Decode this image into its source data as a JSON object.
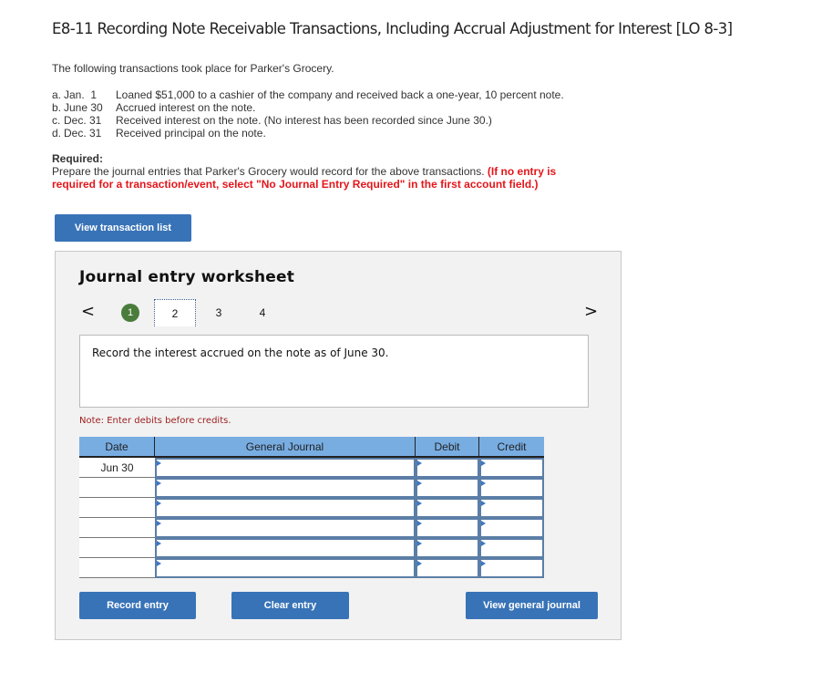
{
  "header": {
    "title": "E8-11 Recording Note Receivable Transactions, Including Accrual Adjustment for Interest [LO 8-3]"
  },
  "intro": "The following transactions took place for Parker's Grocery.",
  "transactions": [
    {
      "letter": "a.",
      "date": "Jan.  1",
      "text": "Loaned $51,000 to a cashier of the company and received back a one-year, 10 percent note."
    },
    {
      "letter": "b.",
      "date": "June 30",
      "text": "Accrued interest on the note."
    },
    {
      "letter": "c.",
      "date": "Dec. 31",
      "text": "Received interest on the note. (No interest has been recorded since June 30.)"
    },
    {
      "letter": "d.",
      "date": "Dec. 31",
      "text": "Received principal on the note."
    }
  ],
  "required": {
    "heading": "Required:",
    "text": "Prepare the journal entries that Parker's Grocery would record for the above transactions.",
    "warning": "(If no entry is required for a transaction/event, select \"No Journal Entry Required\" in the first account field.)"
  },
  "buttons": {
    "view_transaction_list": "View transaction list",
    "record_entry": "Record entry",
    "clear_entry": "Clear entry",
    "view_general_journal": "View general journal"
  },
  "worksheet": {
    "title": "Journal entry worksheet",
    "nav_prev": "<",
    "nav_next": ">",
    "steps": [
      {
        "label": "1",
        "state": "completed"
      },
      {
        "label": "2",
        "state": "active"
      },
      {
        "label": "3",
        "state": "pending"
      },
      {
        "label": "4",
        "state": "pending"
      }
    ],
    "description": "Record the interest accrued on the note as of June 30.",
    "note": "Note: Enter debits before credits."
  },
  "journal": {
    "columns": [
      "Date",
      "General Journal",
      "Debit",
      "Credit"
    ],
    "rows": [
      {
        "date": "Jun 30",
        "account": "",
        "debit": "",
        "credit": ""
      },
      {
        "date": "",
        "account": "",
        "debit": "",
        "credit": ""
      },
      {
        "date": "",
        "account": "",
        "debit": "",
        "credit": ""
      },
      {
        "date": "",
        "account": "",
        "debit": "",
        "credit": ""
      },
      {
        "date": "",
        "account": "",
        "debit": "",
        "credit": ""
      },
      {
        "date": "",
        "account": "",
        "debit": "",
        "credit": ""
      }
    ]
  },
  "colors": {
    "button": "#3873b7",
    "table_header": "#78ade2",
    "cell_border": "#5b7ea6",
    "step_done": "#4a7c3b",
    "warning": "#e4161b",
    "note": "#9e1b1b"
  }
}
